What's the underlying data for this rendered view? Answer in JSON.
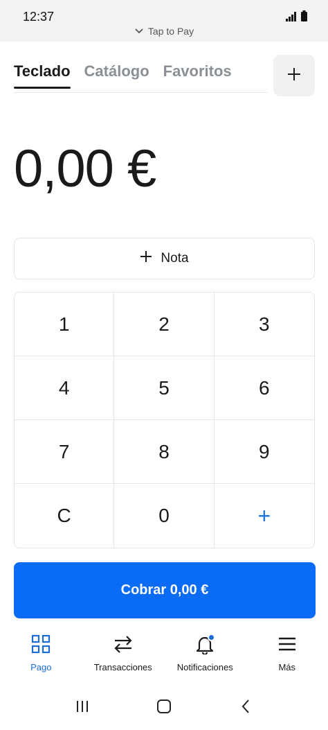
{
  "status": {
    "time": "12:37",
    "tap_to_pay": "Tap to Pay"
  },
  "tabs": [
    {
      "label": "Teclado",
      "active": true
    },
    {
      "label": "Catálogo",
      "active": false
    },
    {
      "label": "Favoritos",
      "active": false
    }
  ],
  "amount": "0,00 €",
  "note_label": "Nota",
  "keypad": [
    "1",
    "2",
    "3",
    "4",
    "5",
    "6",
    "7",
    "8",
    "9",
    "C",
    "0",
    "+"
  ],
  "charge_label": "Cobrar 0,00 €",
  "bottom_nav": [
    {
      "label": "Pago",
      "icon": "grid-icon",
      "active": true
    },
    {
      "label": "Transacciones",
      "icon": "transfer-icon",
      "active": false
    },
    {
      "label": "Notificaciones",
      "icon": "bell-icon",
      "active": false,
      "badge": true
    },
    {
      "label": "Más",
      "icon": "menu-icon",
      "active": false
    }
  ],
  "colors": {
    "accent": "#0a6cf5",
    "active_nav": "#1a6dd8"
  }
}
